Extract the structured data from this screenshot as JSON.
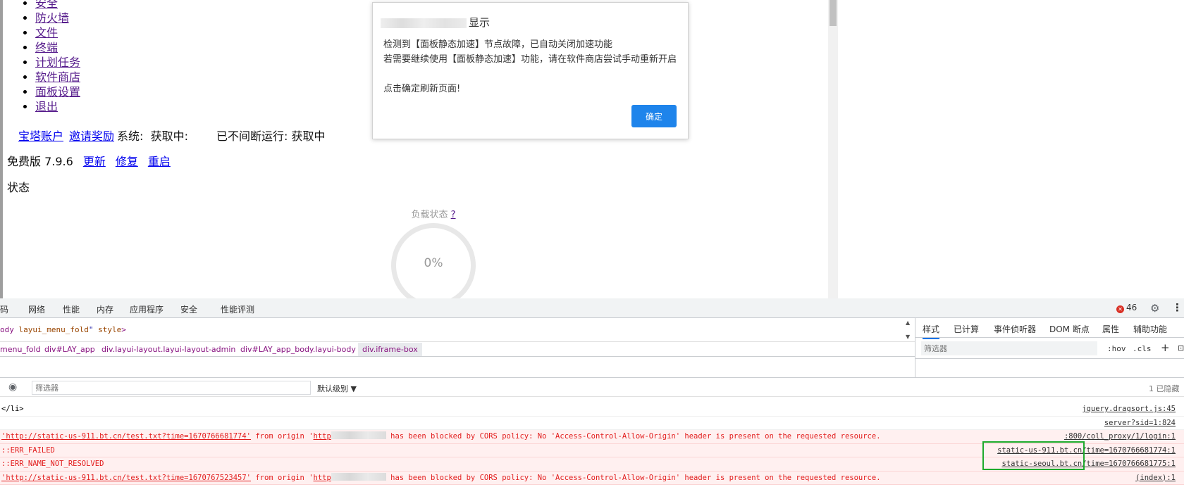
{
  "nav": {
    "items": [
      "安全",
      "防火墙",
      "文件",
      "终端",
      "计划任务",
      "软件商店",
      "面板设置",
      "退出"
    ]
  },
  "account": {
    "account_link": "宝塔账户",
    "invite_link": "邀请奖励",
    "system_label": "系统:",
    "system_value": "获取中:",
    "uptime_label": "已不间断运行:",
    "uptime_value": "获取中"
  },
  "version": {
    "label": "免费版 7.9.6",
    "update": "更新",
    "repair": "修复",
    "restart": "重启"
  },
  "status": {
    "label": "状态",
    "load_title": "负载状态",
    "load_help": "?",
    "load_value": "0%"
  },
  "modal": {
    "title": "显示",
    "lines": [
      "检测到【面板静态加速】节点故障，已自动关闭加速功能",
      "若需要继续使用【面板静态加速】功能，请在软件商店尝试手动重新开启",
      "",
      "点击确定刷新页面!"
    ],
    "ok_label": "确定"
  },
  "devtools": {
    "tabs": [
      "代码",
      "网络",
      "性能",
      "内存",
      "应用程序",
      "安全",
      "性能评测"
    ],
    "error_count": "46",
    "element_line": {
      "pre": "ody",
      "class_value": "layui_menu_fold",
      "attr": "style",
      "post": ">"
    },
    "breadcrumbs": [
      "menu_fold",
      "div#LAY_app",
      "div.layui-layout.layui-layout-admin",
      "div#LAY_app_body.layui-body",
      "div.iframe-box"
    ],
    "styles_tabs": [
      "样式",
      "已计算",
      "事件侦听器",
      "DOM 断点",
      "属性",
      "辅助功能"
    ],
    "styles_filter_placeholder": "筛选器",
    "hov": ":hov",
    "cls": ".cls",
    "console_filter_placeholder": "筛选器",
    "level": "默认级别 ▼",
    "hidden": "1 已隐藏"
  },
  "console": {
    "rows": [
      {
        "type": "normal",
        "msg": "</li>",
        "src": "jquery.dragsort.js:45"
      },
      {
        "type": "normal",
        "msg": "",
        "src": "server?sid=1:824"
      },
      {
        "type": "error",
        "url": "'http://static-us-911.bt.cn/test.txt?time=1670766681774'",
        "mid": " from origin '",
        "origin": "http",
        "tail": "  has been blocked by CORS policy: No 'Access-Control-Allow-Origin' header is present on the requested resource.",
        "src": ":800/coll_proxy/1/login:1"
      },
      {
        "type": "error",
        "msg": "::ERR_FAILED",
        "src": "static-us-911.bt.cn/time=1670766681774:1"
      },
      {
        "type": "error",
        "msg": "::ERR_NAME_NOT_RESOLVED",
        "src": "static-seoul.bt.cn/time=1670766681775:1"
      },
      {
        "type": "error",
        "url": "'http://static-us-911.bt.cn/test.txt?time=1670767523457'",
        "mid": " from origin '",
        "origin": "http",
        "tail": "  has been blocked by CORS policy: No 'Access-Control-Allow-Origin' header is present on the requested resource.",
        "src": "(index):1"
      }
    ]
  },
  "colors": {
    "primary_button": "#1e84eb",
    "highlight_box": "#1faa2d",
    "error_text": "#e21d1d"
  }
}
